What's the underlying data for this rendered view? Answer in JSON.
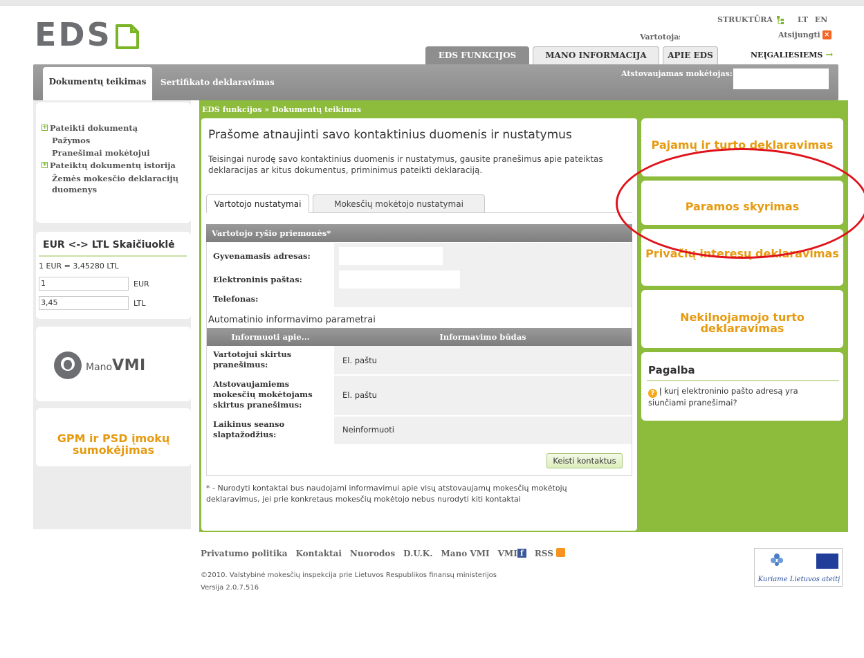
{
  "header": {
    "logo_text": "EDS",
    "struktura": "STRUKTŪRA",
    "lang": [
      "LT",
      "EN"
    ],
    "user_label": "Vartotojas",
    "logout": "Atsijungti",
    "tabs": [
      "EDS FUNKCIJOS",
      "MANO INFORMACIJA",
      "APIE EDS"
    ],
    "accessibility": "NEĮGALIESIEMS",
    "subtabs": [
      "Dokumentų teikimas",
      "Sertifikato deklaravimas"
    ],
    "represented_label": "Atstovaujamas mokėtojas:"
  },
  "sidebar": {
    "items": [
      {
        "label": "Pateikti dokumentą",
        "expandable": true
      },
      {
        "label": "Pažymos",
        "expandable": false
      },
      {
        "label": "Pranešimai mokėtojui",
        "expandable": false
      },
      {
        "label": "Pateiktų dokumentų istorija",
        "expandable": true
      },
      {
        "label": "Žemės mokesčio deklaracijų duomenys",
        "expandable": false
      }
    ],
    "calculator": {
      "title": "EUR <-> LTL Skaičiuoklė",
      "rate": "1 EUR = 3,45280 LTL",
      "eur_value": "1",
      "eur_unit": "EUR",
      "ltl_value": "3,45",
      "ltl_unit": "LTL"
    },
    "manovmi": {
      "mano": "Mano",
      "vmi": "VMI"
    },
    "gpm": "GPM ir PSD įmokų sumokėjimas"
  },
  "main": {
    "breadcrumb": "EDS funkcijos » Dokumentų teikimas",
    "title": "Prašome atnaujinti savo kontaktinius duomenis ir nustatymus",
    "intro": "Teisingai nurodę savo kontaktinius duomenis ir nustatymus, gausite pranešimus apie pateiktas deklaracijas ar kitus dokumentus, priminimus pateikti deklaraciją.",
    "tabs": [
      "Vartotojo nustatymai",
      "Mokesčių mokėtojo nustatymai"
    ],
    "section_header": "Vartotojo ryšio priemonės*",
    "fields": [
      {
        "label": "Gyvenamasis adresas:",
        "value": ""
      },
      {
        "label": "Elektroninis paštas:",
        "value": ""
      },
      {
        "label": "Telefonas:",
        "value": ""
      }
    ],
    "auto_title": "Automatinio informavimo parametrai",
    "table_headers": [
      "Informuoti apie...",
      "Informavimo būdas"
    ],
    "table_rows": [
      {
        "label": "Vartotojui skirtus pranešimus:",
        "value": "El. paštu"
      },
      {
        "label": "Atstovaujamiems mokesčių mokėtojams skirtus pranešimus:",
        "value": "El. paštu"
      },
      {
        "label": "Laikinus seanso slaptažodžius:",
        "value": "Neinformuoti"
      }
    ],
    "button": "Keisti kontaktus",
    "note": "* - Nurodyti kontaktai bus naudojami informavimui apie visų atstovaujamų mokesčių mokėtojų deklaravimus, jei prie konkretaus mokesčių mokėtojo nebus nurodyti kiti kontaktai"
  },
  "right": {
    "boxes": [
      "Pajamų ir turto deklaravimas",
      "Paramos skyrimas",
      "Privačių interesų deklaravimas",
      "Nekilnojamojo turto deklaravimas"
    ],
    "help_title": "Pagalba",
    "help_question": "Į kurį elektroninio pašto adresą yra siunčiami pranešimai?"
  },
  "footer": {
    "links": [
      "Privatumo politika",
      "Kontaktai",
      "Nuorodos",
      "D.U.K.",
      "Mano VMI",
      "VMI",
      "RSS"
    ],
    "copyright": "©2010. Valstybinė mokesčių inspekcija prie Lietuvos Respublikos finansų ministerijos",
    "version": "Versija 2.0.7.516",
    "eu_caption": "Kuriame Lietuvos ateitį"
  },
  "colors": {
    "green": "#8dbb3b",
    "orange": "#e69a10",
    "annotation_red": "#e0121a"
  }
}
